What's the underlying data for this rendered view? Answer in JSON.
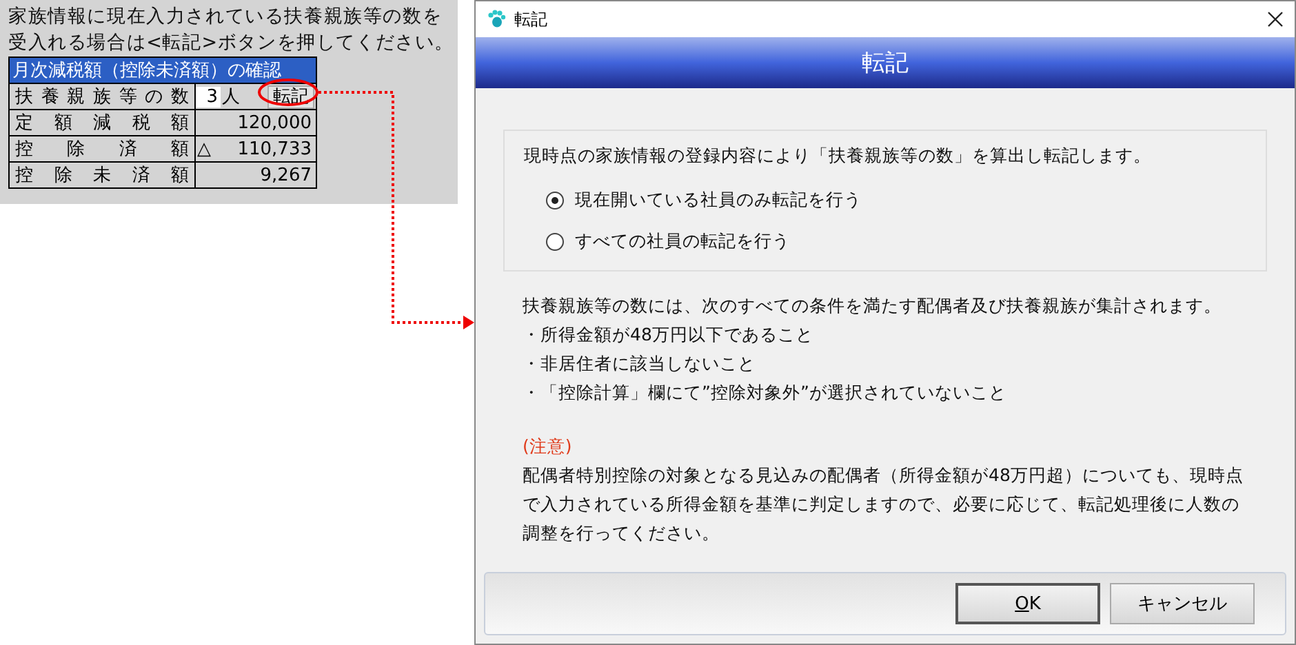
{
  "instruction": "家族情報に現在入力されている扶養親族等の数を受入れる場合は<転記>ボタンを押してください。",
  "table": {
    "title": "月次減税額（控除未済額）の確認",
    "rows": [
      {
        "kind": "input",
        "label": "扶養親族等の数",
        "value": "3",
        "unit": "人",
        "button": "転記"
      },
      {
        "kind": "amount",
        "label": "定額減税額",
        "value": "120,000"
      },
      {
        "kind": "amount",
        "label": "控除済額",
        "prefix": "△",
        "value": "110,733"
      },
      {
        "kind": "amount",
        "label": "控除未済額",
        "value": "9,267"
      }
    ]
  },
  "window": {
    "title": "転記"
  },
  "header": "転記",
  "group": {
    "description": "現時点の家族情報の登録内容により「扶養親族等の数」を算出し転記します。",
    "options": [
      {
        "label": "現在開いている社員のみ転記を行う",
        "selected": true
      },
      {
        "label": "すべての社員の転記を行う",
        "selected": false
      }
    ]
  },
  "notes": {
    "lead": "扶養親族等の数には、次のすべての条件を満たす配偶者及び扶養親族が集計されます。",
    "items": [
      "・所得金額が48万円以下であること",
      "・非居住者に該当しないこと",
      "・「控除計算」欄にて”控除対象外”が選択されていないこと"
    ]
  },
  "caution": {
    "title": "(注意)",
    "text": "配偶者特別控除の対象となる見込みの配偶者（所得金額が48万円超）についても、現時点で入力されている所得金額を基準に判定しますので、必要に応じて、転記処理後に人数の調整を行ってください。"
  },
  "buttons": [
    {
      "kind": "default",
      "label": "OK",
      "mnemonic_first": true
    },
    {
      "kind": "normal",
      "label": "キャンセル",
      "mnemonic_first": false
    }
  ]
}
